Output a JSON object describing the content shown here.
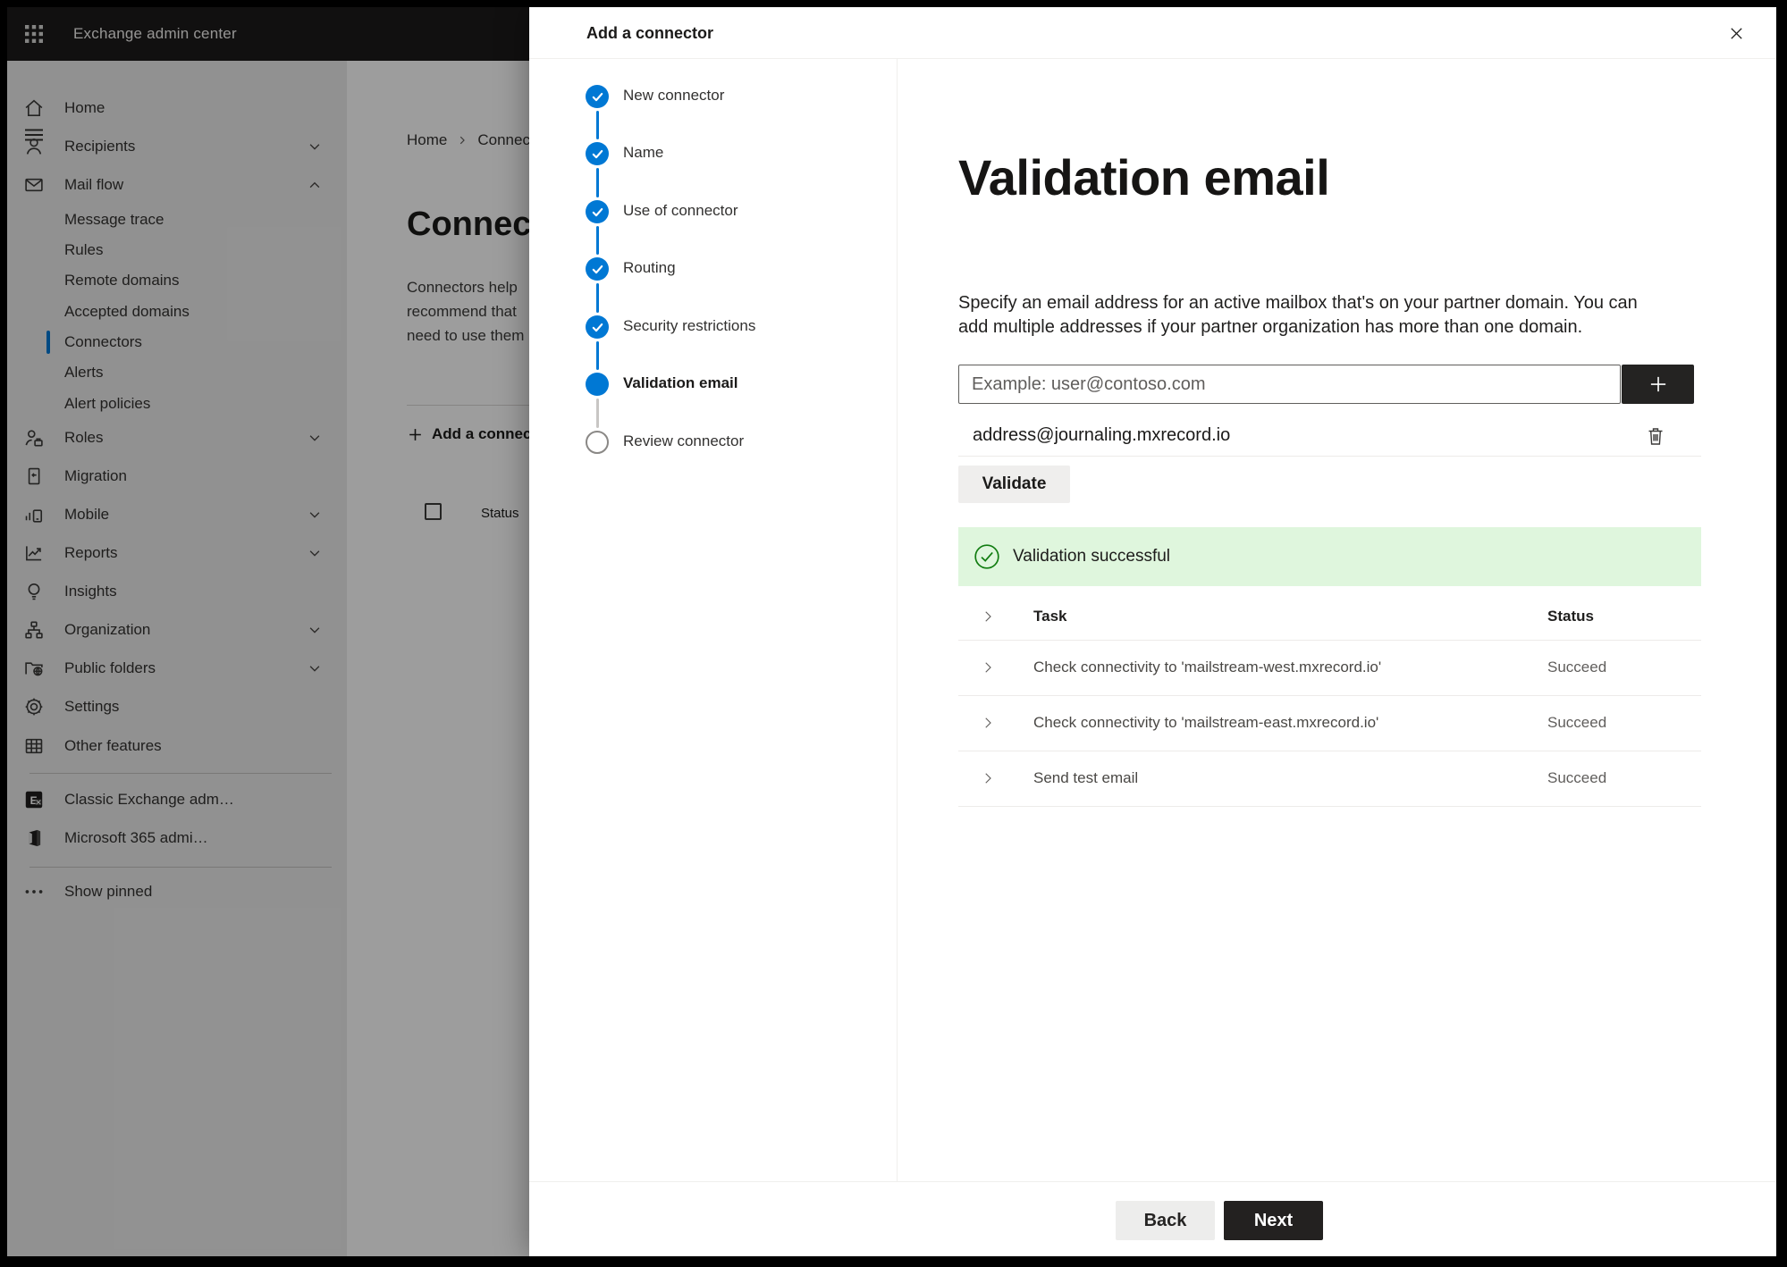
{
  "chrome": {
    "top_bar_title": "Exchange admin center"
  },
  "sidebar": {
    "items": [
      {
        "label": "Home",
        "icon": "home-icon",
        "type": "main"
      },
      {
        "label": "Recipients",
        "icon": "person-icon",
        "type": "main",
        "chevron": "down"
      },
      {
        "label": "Mail flow",
        "icon": "mail-icon",
        "type": "main",
        "chevron": "up"
      },
      {
        "label": "Message trace",
        "type": "sub"
      },
      {
        "label": "Rules",
        "type": "sub"
      },
      {
        "label": "Remote domains",
        "type": "sub"
      },
      {
        "label": "Accepted domains",
        "type": "sub"
      },
      {
        "label": "Connectors",
        "type": "sub",
        "selected": true
      },
      {
        "label": "Alerts",
        "type": "sub"
      },
      {
        "label": "Alert policies",
        "type": "sub"
      },
      {
        "label": "Roles",
        "icon": "roles-icon",
        "type": "main",
        "chevron": "down"
      },
      {
        "label": "Migration",
        "icon": "migration-icon",
        "type": "main"
      },
      {
        "label": "Mobile",
        "icon": "mobile-icon",
        "type": "main",
        "chevron": "down"
      },
      {
        "label": "Reports",
        "icon": "reports-icon",
        "type": "main",
        "chevron": "down"
      },
      {
        "label": "Insights",
        "icon": "insights-icon",
        "type": "main"
      },
      {
        "label": "Organization",
        "icon": "organization-icon",
        "type": "main",
        "chevron": "down"
      },
      {
        "label": "Public folders",
        "icon": "public-folders-icon",
        "type": "main",
        "chevron": "down"
      },
      {
        "label": "Settings",
        "icon": "gear-icon",
        "type": "main"
      },
      {
        "label": "Other features",
        "icon": "table-grid-icon",
        "type": "main"
      },
      {
        "type": "divider"
      },
      {
        "label": "Classic Exchange adm…",
        "icon": "exchange-logo-icon",
        "type": "main"
      },
      {
        "label": "Microsoft 365 admi…",
        "icon": "m365-logo-icon",
        "type": "main"
      },
      {
        "type": "divider"
      },
      {
        "label": "Show pinned",
        "icon": "ellipsis-icon",
        "type": "main"
      }
    ]
  },
  "background_page": {
    "breadcrumb": {
      "home": "Home",
      "current": "Connectors"
    },
    "title": "Connectors",
    "intro_lines": [
      "Connectors help",
      "recommend that",
      "need to use them"
    ],
    "add_button": "Add a connector",
    "status_header": "Status"
  },
  "wizard": {
    "title": "Add a connector",
    "steps": [
      {
        "label": "New connector",
        "state": "done"
      },
      {
        "label": "Name",
        "state": "done"
      },
      {
        "label": "Use of connector",
        "state": "done"
      },
      {
        "label": "Routing",
        "state": "done"
      },
      {
        "label": "Security restrictions",
        "state": "done"
      },
      {
        "label": "Validation email",
        "state": "active"
      },
      {
        "label": "Review connector",
        "state": "todo"
      }
    ]
  },
  "validation": {
    "heading": "Validation email",
    "description": "Specify an email address for an active mailbox that's on your partner domain. You can add multiple addresses if your partner organization has more than one domain.",
    "input_placeholder": "Example: user@contoso.com",
    "added_address": "address@journaling.mxrecord.io",
    "validate_button": "Validate",
    "banner_text": "Validation successful",
    "table": {
      "task_header": "Task",
      "status_header": "Status",
      "rows": [
        {
          "task": "Check connectivity to 'mailstream-west.mxrecord.io'",
          "status": "Succeed"
        },
        {
          "task": "Check connectivity to 'mailstream-east.mxrecord.io'",
          "status": "Succeed"
        },
        {
          "task": "Send test email",
          "status": "Succeed"
        }
      ]
    }
  },
  "footer": {
    "back_label": "Back",
    "next_label": "Next"
  },
  "colors": {
    "accent_blue": "#0078d4",
    "success_green": "#107c10",
    "banner_green_bg": "#dff6dd",
    "dark_button": "#232120",
    "topbar_bg": "#1c1b1a"
  }
}
